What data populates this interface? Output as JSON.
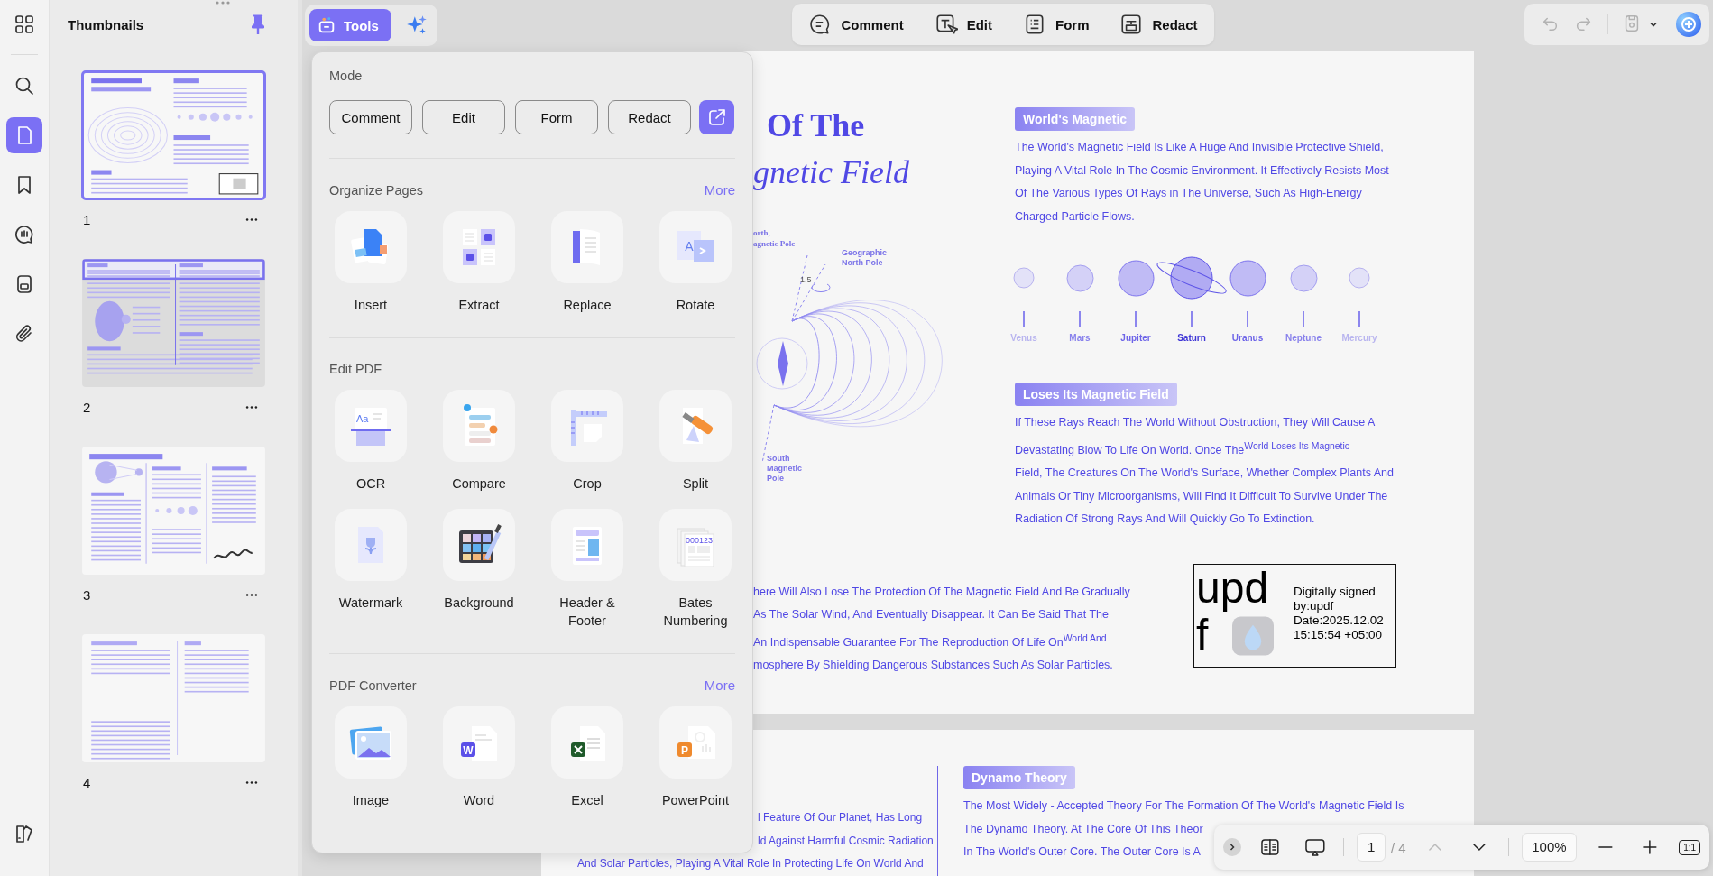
{
  "rail": {
    "items": [
      {
        "selected": false
      },
      {
        "selected": false
      },
      {
        "selected": true
      },
      {
        "selected": false
      },
      {
        "selected": false
      },
      {
        "selected": false
      },
      {
        "selected": false
      }
    ]
  },
  "thumbnails": {
    "title": "Thumbnails",
    "pinned": true,
    "pages": [
      {
        "number": "1",
        "selected": true
      },
      {
        "number": "2",
        "selected": false
      },
      {
        "number": "3",
        "selected": false
      },
      {
        "number": "4",
        "selected": false
      }
    ]
  },
  "top_bar": {
    "tools": {
      "label": "Tools",
      "selected": true
    },
    "modes": [
      {
        "label": "Comment"
      },
      {
        "label": "Edit"
      },
      {
        "label": "Form"
      },
      {
        "label": "Redact"
      }
    ],
    "undo_enabled": false,
    "redo_enabled": false
  },
  "tools_popup": {
    "mode": {
      "title": "Mode",
      "buttons": [
        {
          "label": "Comment"
        },
        {
          "label": "Edit"
        },
        {
          "label": "Form"
        },
        {
          "label": "Redact"
        }
      ]
    },
    "sections": [
      {
        "title": "Organize Pages",
        "more": "More",
        "tools": [
          {
            "label": "Insert"
          },
          {
            "label": "Extract"
          },
          {
            "label": "Replace"
          },
          {
            "label": "Rotate",
            "glyph": "A"
          }
        ]
      },
      {
        "title": "Edit PDF",
        "tools": [
          {
            "label": "OCR",
            "glyph": "Aa"
          },
          {
            "label": "Compare"
          },
          {
            "label": "Crop"
          },
          {
            "label": "Split"
          },
          {
            "label": "Watermark"
          },
          {
            "label": "Background"
          },
          {
            "label": "Header & Footer"
          },
          {
            "label": "Bates Numbering",
            "glyph": "000123"
          }
        ]
      },
      {
        "title": "PDF Converter",
        "more": "More",
        "tools": [
          {
            "label": "Image"
          },
          {
            "label": "Word",
            "glyph": "W"
          },
          {
            "label": "Excel"
          },
          {
            "label": "PowerPoint",
            "glyph": "P"
          }
        ]
      }
    ]
  },
  "page_1": {
    "title": [
      "Of The",
      "gnetic Field"
    ],
    "diagram_labels": [
      "orth,",
      "agnetic Pole",
      "Geographic North Pole",
      "1.5",
      "South Magnetic Pole"
    ],
    "sections": [
      {
        "tag": "World's Magnetic",
        "lines": [
          "The World's Magnetic Field Is Like A Huge And Invisible Protective Shield,",
          "Playing A Vital Role In The Cosmic Environment. It Effectively Resists Most",
          "Of The Various Types Of Rays in The Universe, Such As High-Energy",
          "Charged Particle Flows."
        ]
      },
      {
        "tag": "Loses Its Magnetic Field",
        "lines": [
          "If These Rays Reach The World Without Obstruction, They Will Cause A",
          "Devastating Blow To Life On World. Once The$^{World Loses Its Magnetic}$",
          "Field, The Creatures On The World's Surface, Whether Complex Plants And",
          "Animals Or Tiny Microorganisms, Will Find It Difficult To Survive Under The",
          "Radiation Of Strong Rays And Will Quickly Go To Extinction."
        ]
      }
    ],
    "planets": [
      {
        "name": "Venus",
        "kind": "small"
      },
      {
        "name": "Mars",
        "kind": "medium"
      },
      {
        "name": "Jupiter",
        "kind": "large"
      },
      {
        "name": "Saturn",
        "kind": "ringed"
      },
      {
        "name": "Uranus",
        "kind": "large"
      },
      {
        "name": "Neptune",
        "kind": "medium"
      },
      {
        "name": "Mercury",
        "kind": "small"
      }
    ],
    "lower_lines": [
      "here Will Also Lose The Protection Of The Magnetic Field And Be Gradually",
      "As The Solar Wind, And Eventually Disappear. It Can Be Said That The",
      "An Indispensable Guarantee For The Reproduction Of Life On$^{World And}$",
      "mosphere By Shielding Dangerous Substances Such As Solar Particles."
    ],
    "signature": {
      "mark": [
        "upd",
        "f"
      ],
      "lines": [
        "Digitally signed",
        "by:updf",
        "Date:2025.12.02",
        "15:15:54 +05:00"
      ]
    }
  },
  "page_2": {
    "left_lines": [
      "l Feature Of Our Planet, Has Long",
      "ld Against Harmful Cosmic Radiation",
      "And Solar Particles, Playing A Vital Role In Protecting Life On World And"
    ],
    "tag": "Dynamo Theory",
    "lines": [
      "The Most Widely - Accepted Theory For The Formation Of The World's Magnetic Field Is",
      "The Dynamo Theory. At The Core Of This Theor",
      "In The World's Outer Core. The Outer Core Is A"
    ]
  },
  "bottom_bar": {
    "page": "1",
    "total": "/ 4",
    "zoom": "100%",
    "ratio": "1:1",
    "prev_enabled": false,
    "next_enabled": true
  }
}
